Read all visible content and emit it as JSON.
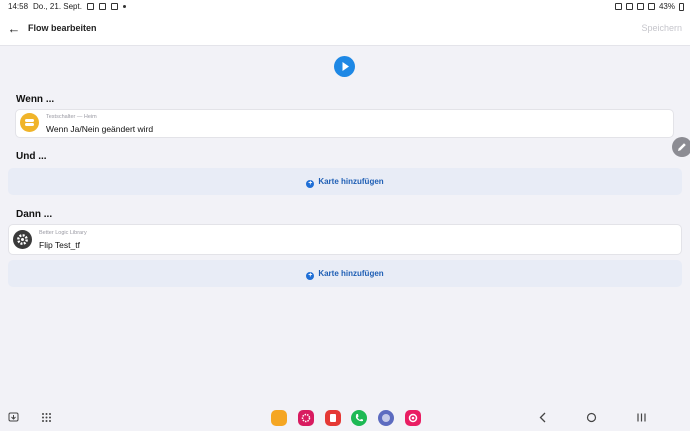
{
  "status_bar": {
    "time": "14:58",
    "date": "Do., 21. Sept.",
    "battery": "43%"
  },
  "header": {
    "back_icon": "arrow-left-icon",
    "title": "Flow bearbeiten",
    "save_label": "Speichern"
  },
  "play_icon": "play-icon",
  "sections": {
    "when_label": "Wenn ...",
    "and_label": "Und ...",
    "then_label": "Dann ..."
  },
  "when_card": {
    "subtitle": "Testschalter — Heim",
    "title": "Wenn Ja/Nein  geändert wird",
    "icon_color": "#f0b429"
  },
  "then_card": {
    "subtitle": "Better Logic Library",
    "title": "Flip Test_tf",
    "icon_color": "#3a3a3a"
  },
  "add_card_label": "Karte hinzufügen",
  "colors": {
    "accent": "#1e88e5",
    "background": "#f2f2f7"
  },
  "navbar": {
    "apps": [
      {
        "name": "my-files-app-icon",
        "color": "#f5a623"
      },
      {
        "name": "blossom-app-icon",
        "color": "#d81b60"
      },
      {
        "name": "notes-app-icon",
        "color": "#e53935"
      },
      {
        "name": "phone-app-icon",
        "color": "#1db954"
      },
      {
        "name": "internet-app-icon",
        "color": "#5c6bc0"
      },
      {
        "name": "screen-recorder-app-icon",
        "color": "#e91e63"
      }
    ]
  }
}
